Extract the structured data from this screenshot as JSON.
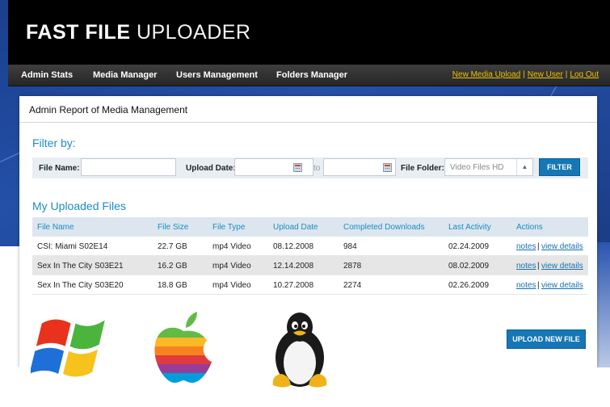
{
  "brand": {
    "logo_bold": "FAST FILE",
    "logo_thin": "UPLOADER"
  },
  "nav": {
    "items": [
      "Admin Stats",
      "Media Manager",
      "Users Management",
      "Folders Manager"
    ],
    "links": [
      "New Media Upload",
      "New User",
      "Log Out"
    ],
    "link_color": "#f2c200"
  },
  "panel": {
    "title": "Admin Report of Media Management"
  },
  "filter": {
    "heading": "Filter by:",
    "file_name_label": "File Name:",
    "file_name_value": "",
    "upload_date_label": "Upload Date:",
    "date_from": "",
    "to_label": "to",
    "date_to": "",
    "folder_label": "File Folder:",
    "folder_selected": "Video Files HD",
    "button": "FILTER",
    "calendar_icon": "calendar-icon"
  },
  "files": {
    "heading": "My Uploaded Files",
    "columns": [
      "File Name",
      "File Size",
      "File Type",
      "Upload Date",
      "Completed Downloads",
      "Last Activity",
      "Actions"
    ],
    "rows": [
      {
        "name": "CSI: Miami S02E14",
        "size": "22.7 GB",
        "type": "mp4 Video",
        "upload": "08.12.2008",
        "downloads": "984",
        "last": "02.24.2009",
        "notes": "notes",
        "details": "view details"
      },
      {
        "name": "Sex In The City S03E21",
        "size": "16.2 GB",
        "type": "mp4 Video",
        "upload": "12.14.2008",
        "downloads": "2878",
        "last": "08.02.2009",
        "notes": "notes",
        "details": "view details"
      },
      {
        "name": "Sex In The City S03E20",
        "size": "18.8 GB",
        "type": "mp4 Video",
        "upload": "10.27.2008",
        "downloads": "2274",
        "last": "02.26.2009",
        "notes": "notes",
        "details": "view details"
      }
    ],
    "separator": "|",
    "upload_button": "UPLOAD NEW FILE"
  },
  "logos": [
    "windows-logo",
    "apple-logo",
    "linux-tux-logo"
  ],
  "colors": {
    "accent": "#1a8dc6",
    "button": "#1677b6",
    "header": "#000000",
    "background": "#2450a8"
  }
}
